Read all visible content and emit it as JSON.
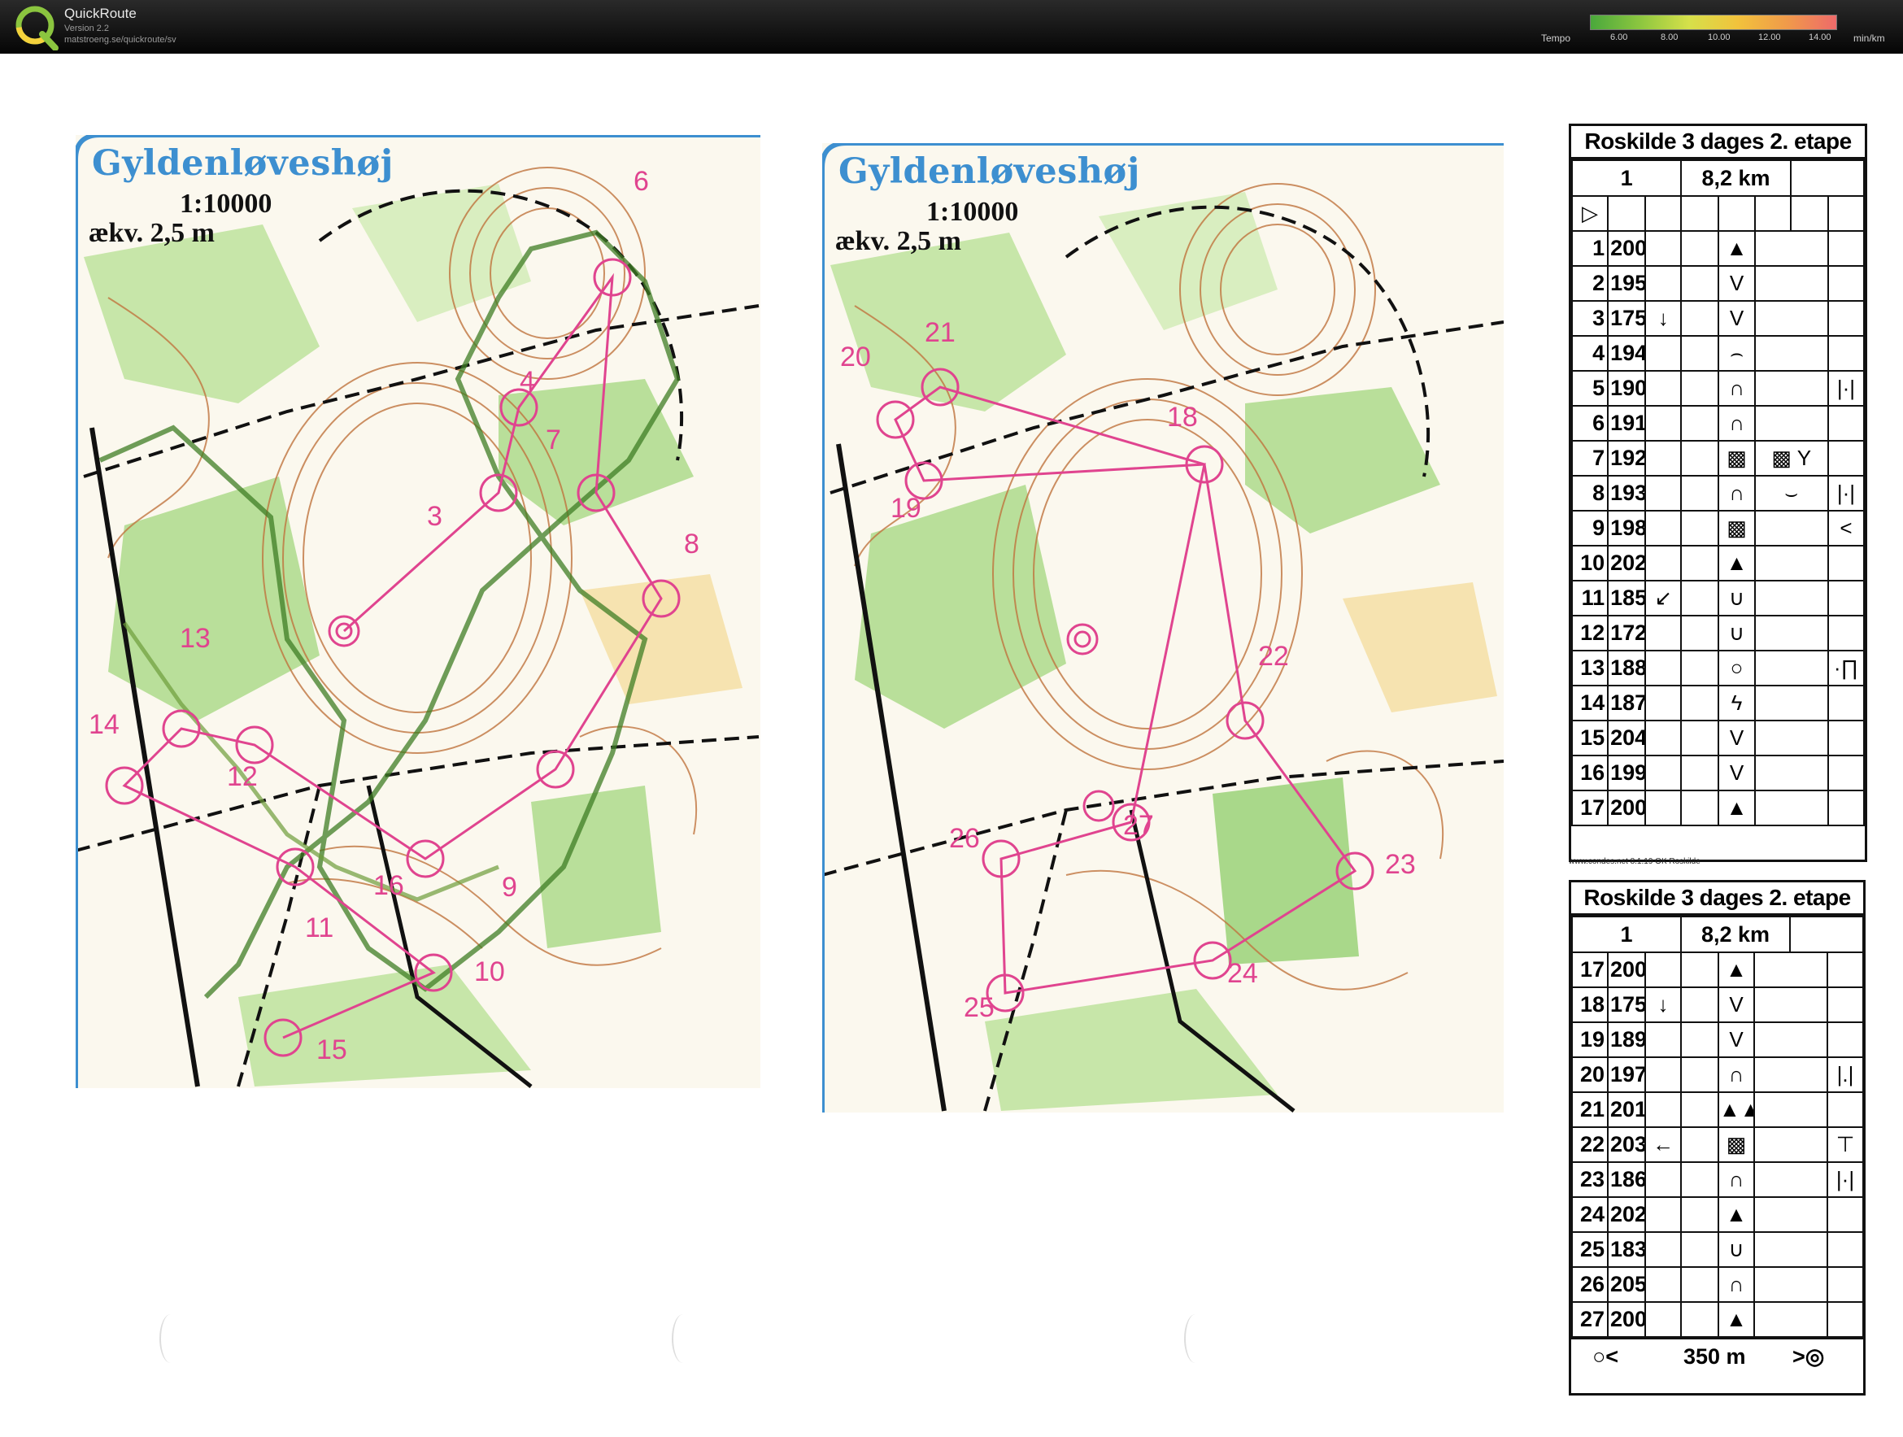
{
  "app": {
    "name": "QuickRoute",
    "version": "Version 2.2",
    "url": "matstroeng.se/quickroute/sv"
  },
  "tempo": {
    "label": "Tempo",
    "unit": "min/km",
    "ticks": [
      "6.00",
      "8.00",
      "10.00",
      "12.00",
      "14.00"
    ],
    "gradient": [
      "#4aa83c",
      "#8cc63f",
      "#d6e04a",
      "#f2c23c",
      "#f09a4a",
      "#ee6a6a"
    ]
  },
  "colors": {
    "course": "#e0448f",
    "route": "#3f7d24",
    "map_title": "#3d8fd0",
    "forest": "#b9df9a",
    "contour": "#c0743e"
  },
  "maps": [
    {
      "title": "Gyldenløveshøj",
      "scale": "1:10000",
      "equidistance": "ækv. 2,5 m",
      "controls": [
        "3",
        "4",
        "6",
        "7",
        "8",
        "9",
        "10",
        "11",
        "12",
        "13",
        "14",
        "15",
        "16"
      ]
    },
    {
      "title": "Gyldenløveshøj",
      "scale": "1:10000",
      "equidistance": "ækv. 2,5 m",
      "controls": [
        "18",
        "19",
        "20",
        "21",
        "22",
        "23",
        "24",
        "25",
        "26",
        "27"
      ]
    }
  ],
  "descriptions": [
    {
      "title": "Roskilde 3 dages 2. etape",
      "class": "1",
      "length": "8,2 km",
      "start_symbol": "▷",
      "rows": [
        {
          "n": "1",
          "code": "200",
          "dir": "",
          "feature": "▲",
          "extra": "",
          "detail": ""
        },
        {
          "n": "2",
          "code": "195",
          "dir": "",
          "feature": "V",
          "extra": "",
          "detail": ""
        },
        {
          "n": "3",
          "code": "175",
          "dir": "↓",
          "feature": "V",
          "extra": "",
          "detail": ""
        },
        {
          "n": "4",
          "code": "194",
          "dir": "",
          "feature": "⌢",
          "extra": "",
          "detail": ""
        },
        {
          "n": "5",
          "code": "190",
          "dir": "",
          "feature": "∩",
          "extra": "",
          "detail": "|·|"
        },
        {
          "n": "6",
          "code": "191",
          "dir": "",
          "feature": "∩",
          "extra": "",
          "detail": ""
        },
        {
          "n": "7",
          "code": "192",
          "dir": "",
          "feature": "▩",
          "extra": "▩ Y",
          "detail": ""
        },
        {
          "n": "8",
          "code": "193",
          "dir": "",
          "feature": "∩",
          "extra": "⌣",
          "detail": "|·|"
        },
        {
          "n": "9",
          "code": "198",
          "dir": "",
          "feature": "▩",
          "extra": "",
          "detail": "<"
        },
        {
          "n": "10",
          "code": "202",
          "dir": "",
          "feature": "▲",
          "extra": "",
          "detail": ""
        },
        {
          "n": "11",
          "code": "185",
          "dir": "↙",
          "feature": "∪",
          "extra": "",
          "detail": ""
        },
        {
          "n": "12",
          "code": "172",
          "dir": "",
          "feature": "∪",
          "extra": "",
          "detail": ""
        },
        {
          "n": "13",
          "code": "188",
          "dir": "",
          "feature": "○",
          "extra": "",
          "detail": "·∏"
        },
        {
          "n": "14",
          "code": "187",
          "dir": "",
          "feature": "ϟ",
          "extra": "",
          "detail": ""
        },
        {
          "n": "15",
          "code": "204",
          "dir": "",
          "feature": "V",
          "extra": "",
          "detail": ""
        },
        {
          "n": "16",
          "code": "199",
          "dir": "",
          "feature": "V",
          "extra": "",
          "detail": ""
        },
        {
          "n": "17",
          "code": "200",
          "dir": "",
          "feature": "▲",
          "extra": "",
          "detail": ""
        }
      ],
      "credit": "www.condes.net 8.1.19 OK Roskilde"
    },
    {
      "title": "Roskilde 3 dages 2. etape",
      "class": "1",
      "length": "8,2 km",
      "rows": [
        {
          "n": "17",
          "code": "200",
          "dir": "",
          "feature": "▲",
          "extra": "",
          "detail": ""
        },
        {
          "n": "18",
          "code": "175",
          "dir": "↓",
          "feature": "V",
          "extra": "",
          "detail": ""
        },
        {
          "n": "19",
          "code": "189",
          "dir": "",
          "feature": "V",
          "extra": "",
          "detail": ""
        },
        {
          "n": "20",
          "code": "197",
          "dir": "",
          "feature": "∩",
          "extra": "",
          "detail": "|.|"
        },
        {
          "n": "21",
          "code": "201",
          "dir": "",
          "feature": "▲▲",
          "extra": "",
          "detail": ""
        },
        {
          "n": "22",
          "code": "203",
          "dir": "←",
          "feature": "▩",
          "extra": "",
          "detail": "⊤"
        },
        {
          "n": "23",
          "code": "186",
          "dir": "",
          "feature": "∩",
          "extra": "",
          "detail": "|·|"
        },
        {
          "n": "24",
          "code": "202",
          "dir": "",
          "feature": "▲",
          "extra": "",
          "detail": ""
        },
        {
          "n": "25",
          "code": "183",
          "dir": "",
          "feature": "∪",
          "extra": "",
          "detail": ""
        },
        {
          "n": "26",
          "code": "205",
          "dir": "",
          "feature": "∩",
          "extra": "",
          "detail": ""
        },
        {
          "n": "27",
          "code": "200",
          "dir": "",
          "feature": "▲",
          "extra": "",
          "detail": ""
        }
      ],
      "finish_left": "○<",
      "finish_distance": "350 m",
      "finish_right": ">◎"
    }
  ]
}
